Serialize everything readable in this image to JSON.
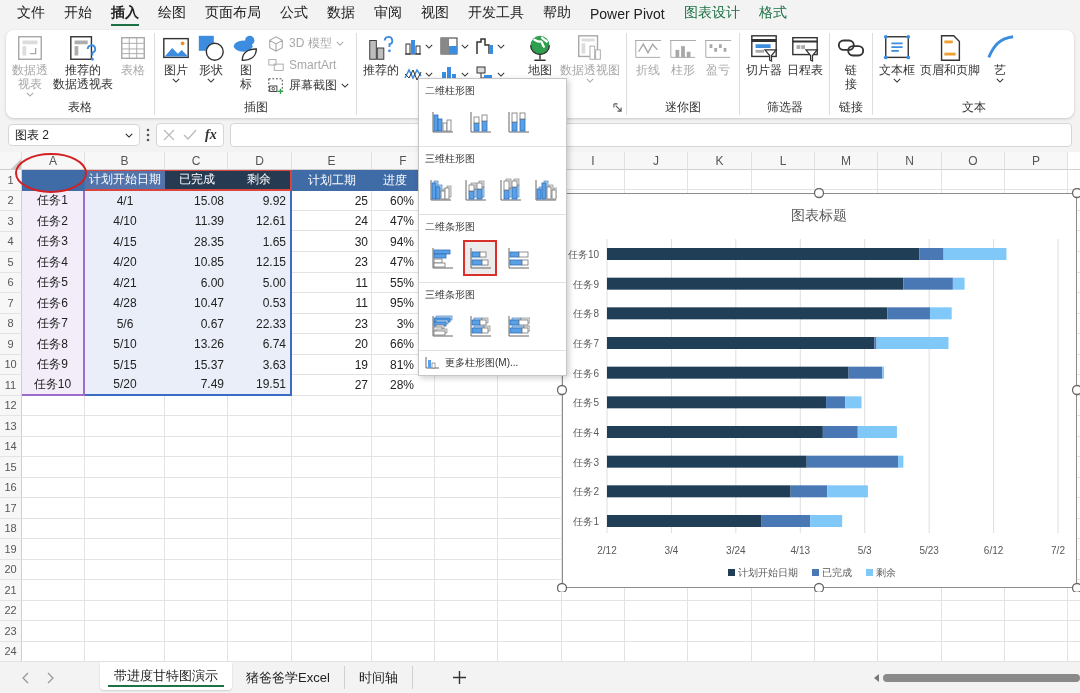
{
  "menu_tabs": [
    {
      "label": "文件",
      "selected": false,
      "contextual": false
    },
    {
      "label": "开始",
      "selected": false,
      "contextual": false
    },
    {
      "label": "插入",
      "selected": true,
      "contextual": false
    },
    {
      "label": "绘图",
      "selected": false,
      "contextual": false
    },
    {
      "label": "页面布局",
      "selected": false,
      "contextual": false
    },
    {
      "label": "公式",
      "selected": false,
      "contextual": false
    },
    {
      "label": "数据",
      "selected": false,
      "contextual": false
    },
    {
      "label": "审阅",
      "selected": false,
      "contextual": false
    },
    {
      "label": "视图",
      "selected": false,
      "contextual": false
    },
    {
      "label": "开发工具",
      "selected": false,
      "contextual": false
    },
    {
      "label": "帮助",
      "selected": false,
      "contextual": false
    },
    {
      "label": "Power Pivot",
      "selected": false,
      "contextual": false
    },
    {
      "label": "图表设计",
      "selected": false,
      "contextual": true
    },
    {
      "label": "格式",
      "selected": false,
      "contextual": true
    }
  ],
  "ribbon": {
    "groups": [
      {
        "label": "表格",
        "items": [
          {
            "kind": "large",
            "lines": [
              "数据透",
              "视表"
            ],
            "disabled": true,
            "dropdown": true
          },
          {
            "kind": "large",
            "lines": [
              "推荐的",
              "数据透视表"
            ],
            "disabled": false,
            "dropdown": false
          },
          {
            "kind": "large",
            "lines": [
              "表格"
            ],
            "disabled": true,
            "dropdown": false
          }
        ]
      },
      {
        "label": "插图",
        "items": [
          {
            "kind": "large",
            "lines": [
              "图片"
            ],
            "disabled": false,
            "dropdown": true
          },
          {
            "kind": "large",
            "lines": [
              "形状"
            ],
            "disabled": false,
            "dropdown": true
          },
          {
            "kind": "large",
            "lines": [
              "图",
              "标"
            ],
            "disabled": false,
            "dropdown": false
          },
          {
            "kind": "small",
            "label": "3D 模型",
            "disabled": true,
            "dropdown": true
          },
          {
            "kind": "small",
            "label": "SmartArt",
            "disabled": true,
            "dropdown": false
          },
          {
            "kind": "small",
            "label": "屏幕截图",
            "disabled": false,
            "dropdown": true
          }
        ]
      },
      {
        "launcher": true,
        "items": [
          {
            "kind": "large",
            "lines": [
              "推荐的"
            ],
            "disabled": false,
            "dropdown": false
          },
          {
            "kind": "icon",
            "disabled": false,
            "dropdown": true
          },
          {
            "kind": "icon",
            "disabled": false,
            "dropdown": true
          },
          {
            "kind": "icon",
            "disabled": false,
            "dropdown": true
          },
          {
            "kind": "icon",
            "disabled": false,
            "dropdown": true
          },
          {
            "kind": "icon",
            "disabled": false,
            "dropdown": true
          },
          {
            "kind": "icon",
            "disabled": false,
            "dropdown": true
          },
          {
            "kind": "large",
            "lines": [
              "地图"
            ],
            "disabled": false,
            "dropdown": true
          },
          {
            "kind": "large",
            "lines": [
              "数据透视图"
            ],
            "disabled": true,
            "dropdown": true
          }
        ]
      },
      {
        "label": "迷你图",
        "items": [
          {
            "kind": "large",
            "lines": [
              "折线"
            ],
            "disabled": true,
            "dropdown": false
          },
          {
            "kind": "large",
            "lines": [
              "柱形"
            ],
            "disabled": true,
            "dropdown": false
          },
          {
            "kind": "large",
            "lines": [
              "盈亏"
            ],
            "disabled": true,
            "dropdown": false
          }
        ]
      },
      {
        "label": "筛选器",
        "items": [
          {
            "kind": "large",
            "lines": [
              "切片器"
            ],
            "disabled": false,
            "dropdown": false
          },
          {
            "kind": "large",
            "lines": [
              "日程表"
            ],
            "disabled": false,
            "dropdown": false
          }
        ]
      },
      {
        "label": "链接",
        "items": [
          {
            "kind": "large",
            "lines": [
              "链",
              "接"
            ],
            "disabled": false,
            "dropdown": false
          }
        ]
      },
      {
        "label": "文本",
        "items": [
          {
            "kind": "large",
            "lines": [
              "文本框"
            ],
            "disabled": false,
            "dropdown": true
          },
          {
            "kind": "large",
            "lines": [
              "页眉和页脚"
            ],
            "disabled": false,
            "dropdown": false
          },
          {
            "kind": "large",
            "lines": [
              "艺"
            ],
            "disabled": false,
            "dropdown": true
          }
        ]
      }
    ]
  },
  "formula_bar": {
    "name_box": "图表 2",
    "function_label": "fx"
  },
  "sheet": {
    "columns": [
      {
        "label": "A"
      },
      {
        "label": "B"
      },
      {
        "label": "C"
      },
      {
        "label": "D"
      },
      {
        "label": "E"
      },
      {
        "label": "F"
      },
      {},
      {},
      {
        "label": "I"
      },
      {
        "label": "J"
      },
      {
        "label": "K"
      },
      {
        "label": "L"
      },
      {
        "label": "M"
      },
      {
        "label": "N"
      },
      {
        "label": "O"
      },
      {
        "label": "P"
      },
      {}
    ],
    "row_numbers": [
      "1",
      "2",
      "3",
      "4",
      "5",
      "6",
      "7",
      "8",
      "9",
      "10",
      "11",
      "12",
      "13",
      "14",
      "15",
      "16",
      "17",
      "18",
      "19",
      "20",
      "21",
      "22",
      "23",
      "24"
    ],
    "table": {
      "header": [
        {
          "color": "#3f6ba6",
          "kind": "category"
        },
        {
          "label": "计划开始日期",
          "color": "#5274ab",
          "kind": "values"
        },
        {
          "label": "已完成",
          "color": "#263a52",
          "kind": "values"
        },
        {
          "label": "剩余",
          "color": "#263a52",
          "kind": "values"
        },
        {
          "label": "计划工期",
          "color": "#3f6ba6",
          "kind": "plain"
        },
        {
          "label": "进度",
          "color": "#3f6ba6",
          "kind": "plain"
        }
      ],
      "rows": [
        [
          "任务1",
          "4/1",
          "15.08",
          "9.92",
          "25",
          "60%"
        ],
        [
          "任务2",
          "4/10",
          "11.39",
          "12.61",
          "24",
          "47%"
        ],
        [
          "任务3",
          "4/15",
          "28.35",
          "1.65",
          "30",
          "94%"
        ],
        [
          "任务4",
          "4/20",
          "10.85",
          "12.15",
          "23",
          "47%"
        ],
        [
          "任务5",
          "4/21",
          "6.00",
          "5.00",
          "11",
          "55%"
        ],
        [
          "任务6",
          "4/28",
          "10.47",
          "0.53",
          "11",
          "95%"
        ],
        [
          "任务7",
          "5/6",
          "0.67",
          "22.33",
          "23",
          "3%"
        ],
        [
          "任务8",
          "5/10",
          "13.26",
          "6.74",
          "20",
          "66%"
        ],
        [
          "任务9",
          "5/15",
          "15.37",
          "3.63",
          "19",
          "81%"
        ],
        [
          "任务10",
          "5/20",
          "7.49",
          "19.51",
          "27",
          "28%"
        ]
      ]
    }
  },
  "chart": {
    "kind": "stacked",
    "title": "图表标题",
    "categories": [
      "任务10",
      "任务9",
      "任务8",
      "任务7",
      "任务6",
      "任务5",
      "任务4",
      "任务3",
      "任务2",
      "任务1"
    ],
    "series": [
      {
        "name": "计划开始日期",
        "color": "#203f56"
      },
      {
        "name": "已完成",
        "color": "#4a78b5"
      },
      {
        "name": "剩余",
        "color": "#80c8f8"
      }
    ],
    "x_axis_labels": [
      "2/12",
      "3/4",
      "3/24",
      "4/13",
      "5/3",
      "5/23",
      "6/12",
      "7/2"
    ]
  },
  "dropdown": {
    "sections": [
      {
        "title": "二维柱形图",
        "kind": "column",
        "options": [
          {
            "selected": false
          },
          {
            "selected": false
          },
          {
            "selected": false
          }
        ]
      },
      {
        "title": "三维柱形图",
        "kind": "column3d",
        "options": [
          {
            "selected": false
          },
          {
            "selected": false
          },
          {
            "selected": false
          },
          {
            "selected": false
          }
        ]
      },
      {
        "title": "二维条形图",
        "kind": "bar",
        "options": [
          {
            "selected": false
          },
          {
            "selected": true
          },
          {
            "selected": false
          }
        ]
      },
      {
        "title": "三维条形图",
        "kind": "bar3d",
        "options": [
          {
            "selected": false
          },
          {
            "selected": false
          },
          {
            "selected": false
          }
        ]
      }
    ],
    "more": "更多柱形图(M)..."
  },
  "sheet_tabs": [
    {
      "label": "带进度甘特图演示",
      "selected": true
    },
    {
      "label": "猪爸爸学Excel",
      "selected": false
    },
    {
      "label": "时间轴",
      "selected": false
    }
  ]
}
